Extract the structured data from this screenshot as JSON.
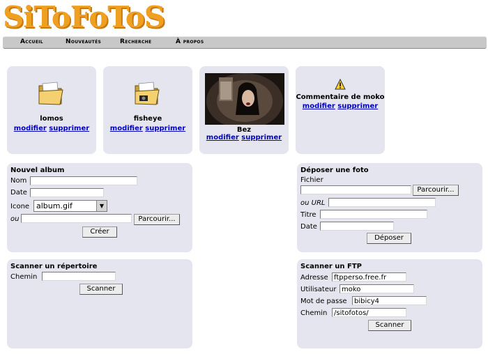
{
  "app": {
    "logo": "SiToFoToS"
  },
  "nav": {
    "items": [
      {
        "label": "Accueil"
      },
      {
        "label": "Nouveautés"
      },
      {
        "label": "Recherche"
      },
      {
        "label": "À propos"
      }
    ]
  },
  "cards": [
    {
      "name": "lomos",
      "modify": "modifier",
      "delete": "supprimer",
      "icon": "folder-icon"
    },
    {
      "name": "fisheye",
      "modify": "modifier",
      "delete": "supprimer",
      "icon": "folder-camera-icon"
    },
    {
      "name": "Bez",
      "modify": "modifier",
      "delete": "supprimer",
      "icon": "photo-thumbnail"
    },
    {
      "name": "Commentaire de moko",
      "modify": "modifier",
      "delete": "supprimer",
      "icon": "warning-icon"
    }
  ],
  "new_album": {
    "title": "Nouvel album",
    "name_label": "Nom",
    "date_label": "Date",
    "icon_label": "Icone",
    "icon_value": "album.gif",
    "or_label": "ou",
    "browse": "Parcourir...",
    "create": "Créer"
  },
  "upload": {
    "title": "Déposer une foto",
    "file_label": "Fichier",
    "browse": "Parcourir...",
    "or_url_label": "ou URL",
    "title_label": "Titre",
    "date_label": "Date",
    "submit": "Déposer"
  },
  "scan_dir": {
    "title": "Scanner un répertoire",
    "path_label": "Chemin",
    "submit": "Scanner"
  },
  "scan_ftp": {
    "title": "Scanner un FTP",
    "address_label": "Adresse",
    "address_value": "ftpperso.free.fr",
    "user_label": "Utilisateur",
    "user_value": "moko",
    "password_label": "Mot de passe",
    "password_value": "bibicy4",
    "path_label": "Chemin",
    "path_value": "/sitofotos/",
    "submit": "Scanner"
  },
  "colors": {
    "logo": "#f0a020",
    "panel": "#e5e5ef",
    "link": "#0000c0",
    "nav": "#c8c8c8"
  }
}
